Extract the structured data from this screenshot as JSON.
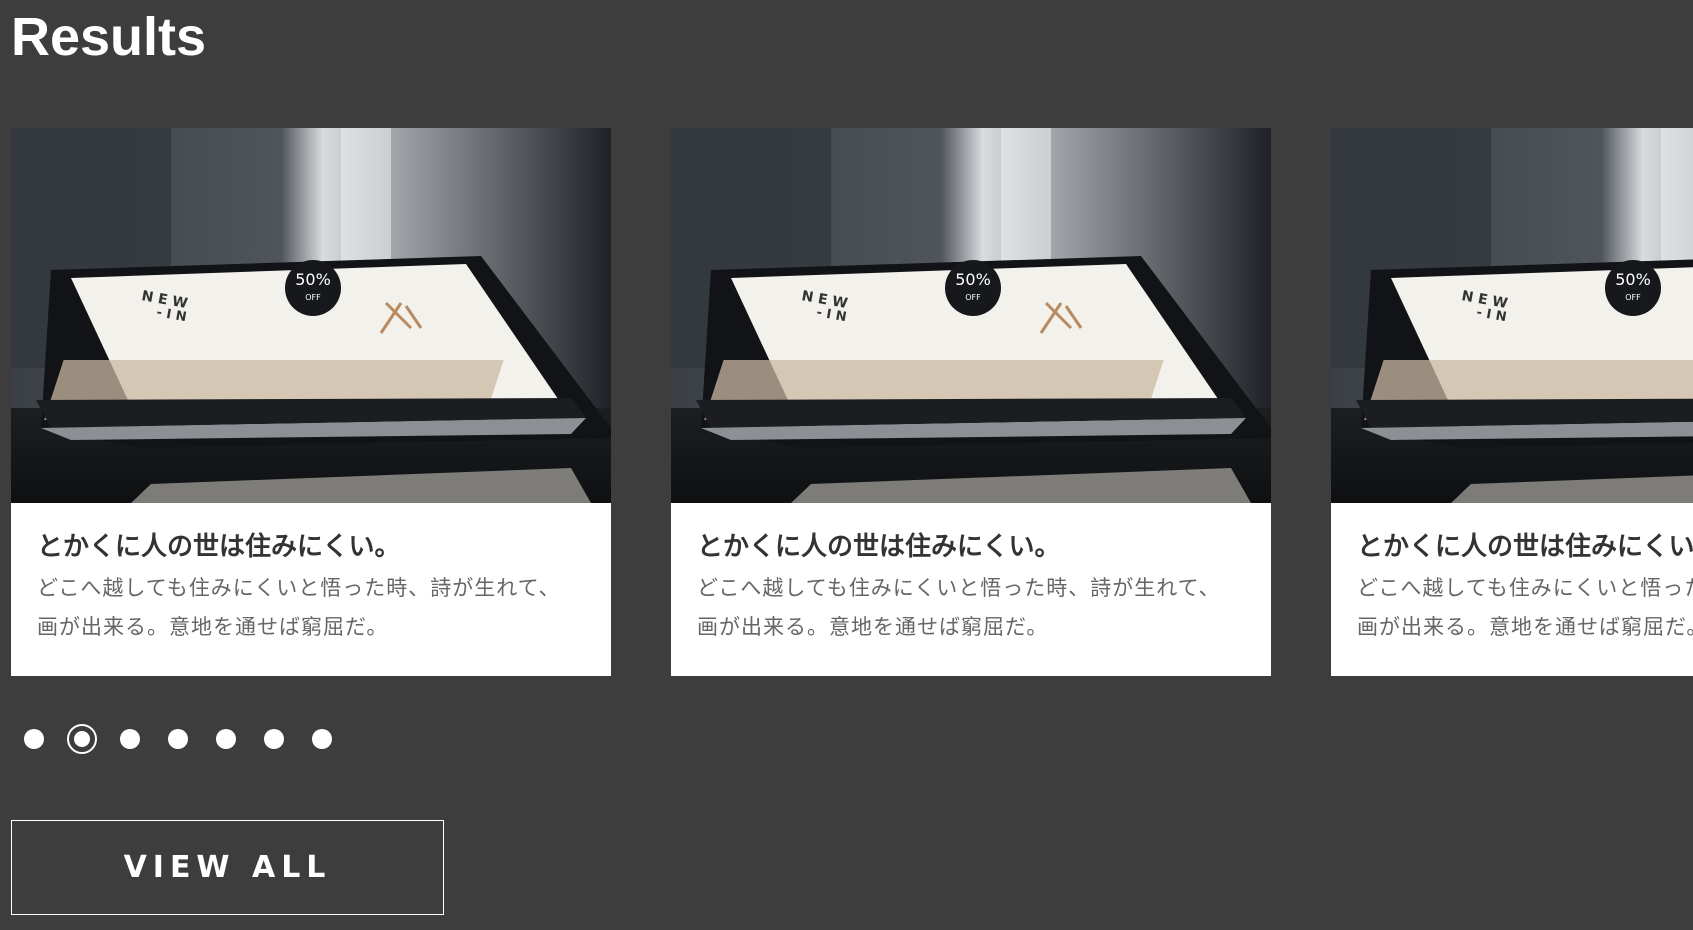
{
  "section": {
    "title": "Results"
  },
  "cards": [
    {
      "title": "とかくに人の世は住みにくい。",
      "text": "どこへ越しても住みにくいと悟った時、詩が生れて、画が出来る。意地を通せば窮屈だ。",
      "screen": {
        "headline_1": "N E W",
        "headline_2": "- I N",
        "badge": "50%",
        "badge_sub": "OFF"
      }
    },
    {
      "title": "とかくに人の世は住みにくい。",
      "text": "どこへ越しても住みにくいと悟った時、詩が生れて、画が出来る。意地を通せば窮屈だ。",
      "screen": {
        "headline_1": "N E W",
        "headline_2": "- I N",
        "badge": "50%",
        "badge_sub": "OFF"
      }
    },
    {
      "title": "とかくに人の世は住みにくい。",
      "text": "どこへ越しても住みにくいと悟った時、詩が生れて、画が出来る。意地を通せば窮屈だ。",
      "screen": {
        "headline_1": "N E W",
        "headline_2": "- I N",
        "badge": "50%",
        "badge_sub": "OFF"
      }
    }
  ],
  "pagination": {
    "count": 7,
    "active_index": 1
  },
  "actions": {
    "view_all": "VIEW ALL"
  },
  "colors": {
    "background": "#3d3d3d",
    "card": "#ffffff",
    "title_text": "#333333",
    "body_text": "#666666"
  }
}
